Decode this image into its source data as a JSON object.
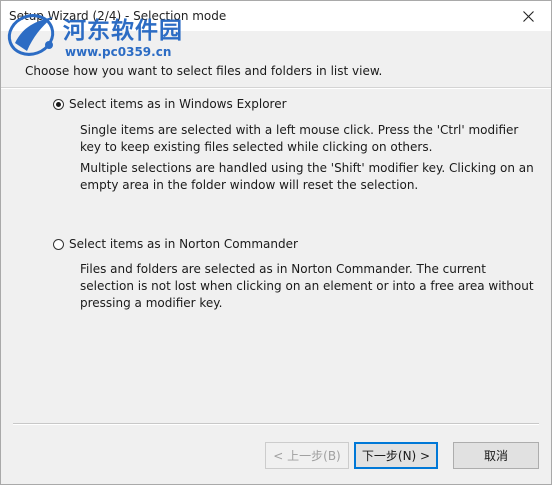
{
  "window": {
    "title": "Setup Wizard (2/4) - Selection mode"
  },
  "watermark": {
    "brand": "河东软件园",
    "url": "www.pc0359.cn"
  },
  "header": {
    "instruction": "Choose how you want to select files and folders in list view."
  },
  "options": [
    {
      "label": "Select items as in Windows Explorer",
      "checked": true,
      "paragraphs": [
        "Single items are selected with a left mouse click. Press the 'Ctrl' modifier key to keep existing files selected while clicking on others.",
        "Multiple selections are handled using the 'Shift' modifier key. Clicking on an empty area in the folder window will reset the selection."
      ]
    },
    {
      "label": "Select items as in Norton Commander",
      "checked": false,
      "paragraphs": [
        "Files and folders are selected as in Norton Commander. The current selection is not lost when clicking on an element or into a free area without pressing a modifier key."
      ]
    }
  ],
  "buttons": {
    "back": "< 上一步(B)",
    "next": "下一步(N) >",
    "cancel": "取消"
  },
  "colors": {
    "accent": "#0078d7",
    "watermark": "#2c6cc4"
  }
}
